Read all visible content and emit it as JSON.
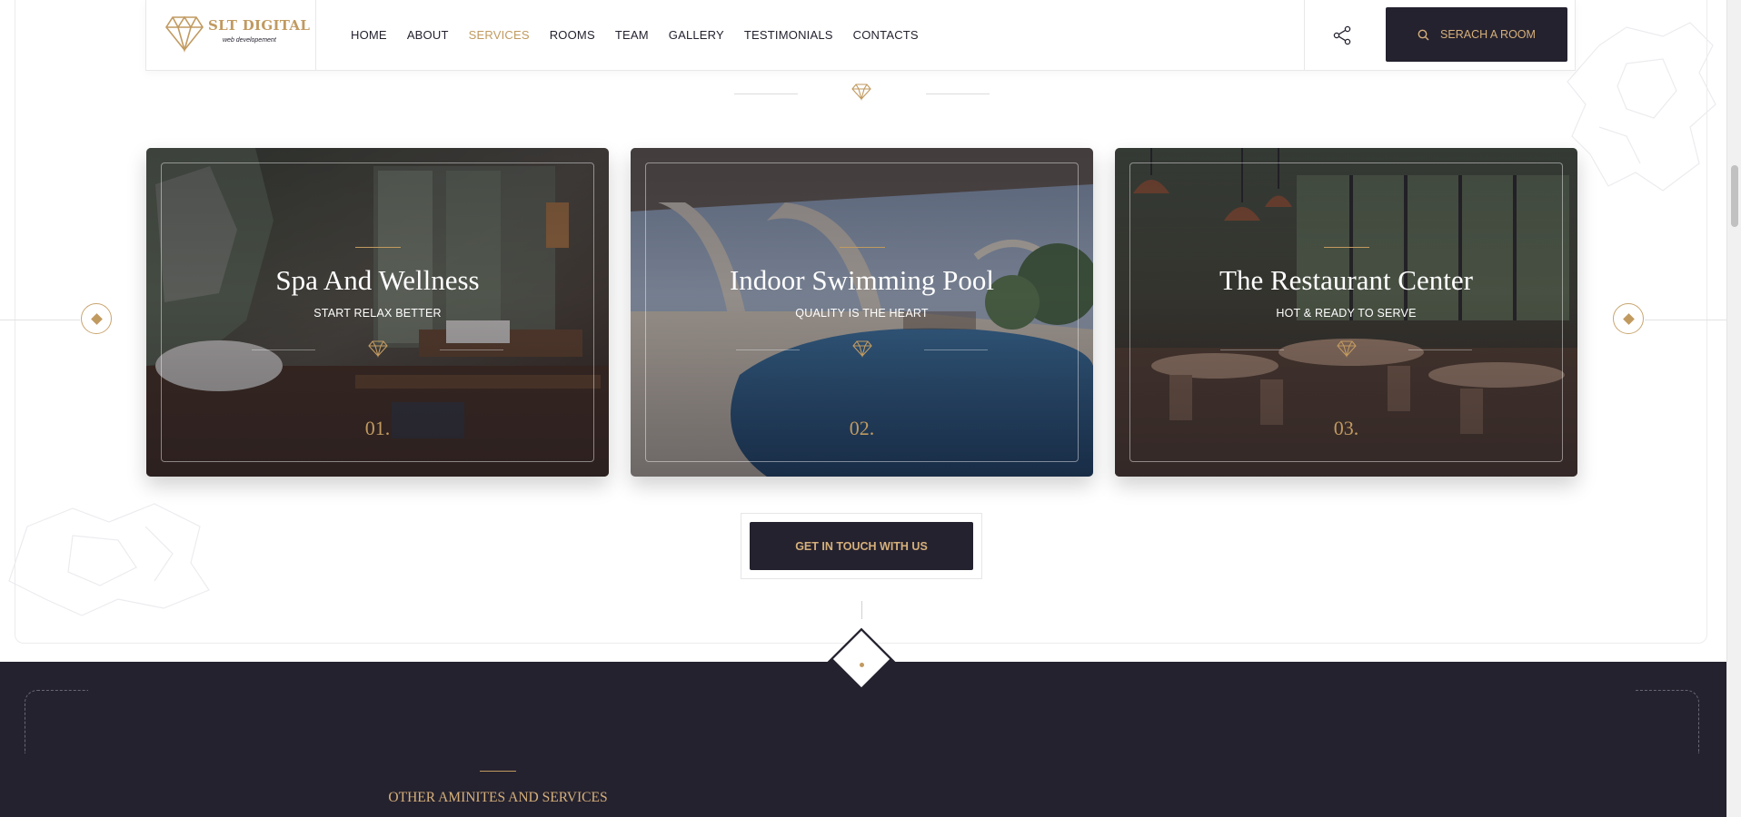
{
  "brand": {
    "name": "SLT DIGITAL",
    "tagline": "web developement",
    "gold": "#c19a60",
    "dark": "#25222f"
  },
  "nav": {
    "items": [
      "HOME",
      "ABOUT",
      "SERVICES",
      "ROOMS",
      "TEAM",
      "GALLERY",
      "TESTIMONIALS",
      "CONTACTS"
    ],
    "active": "SERVICES"
  },
  "header": {
    "share_icon": "share-icon",
    "search_icon": "search-icon",
    "search_label": "SERACH A ROOM"
  },
  "cards": [
    {
      "title": "Spa And Wellness",
      "subtitle": "START RELAX BETTER",
      "number": "01."
    },
    {
      "title": "Indoor Swimming Pool",
      "subtitle": "QUALITY IS THE HEART",
      "number": "02."
    },
    {
      "title": "The Restaurant Center",
      "subtitle": "HOT & READY TO SERVE",
      "number": "03."
    }
  ],
  "cta": {
    "label": "GET IN TOUCH WITH US"
  },
  "amenities": {
    "heading": "OTHER AMINITES AND SERVICES"
  }
}
